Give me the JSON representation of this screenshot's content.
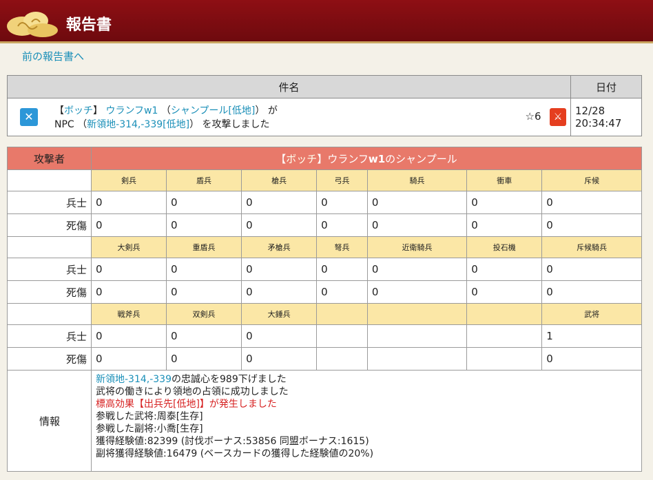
{
  "header": {
    "title": "報告書"
  },
  "back_link": "前の報告書へ",
  "subject_table": {
    "col_subject": "件名",
    "col_date": "日付",
    "row": {
      "alliance": "ボッチ",
      "attacker_name": "ウランフw1",
      "village": "シャンプール[低地]",
      "ga": "が",
      "npc_prefix": "NPC",
      "target": "新領地-314,-339[低地]",
      "action": "を攻撃しました",
      "stars": "☆6",
      "date": "12/28",
      "time": "20:34:47"
    }
  },
  "battle": {
    "attacker_label": "攻撃者",
    "attacker_alliance": "ボッチ",
    "attacker_name": "ウランフ",
    "attacker_name_bold": "w1",
    "attacker_suffix": "のシャンプール",
    "row_soldiers": "兵士",
    "row_casualties": "死傷",
    "groups": [
      {
        "units": [
          "剣兵",
          "盾兵",
          "槍兵",
          "弓兵",
          "騎兵",
          "衝車",
          "斥候"
        ],
        "soldiers": [
          "0",
          "0",
          "0",
          "0",
          "0",
          "0",
          "0"
        ],
        "casualties": [
          "0",
          "0",
          "0",
          "0",
          "0",
          "0",
          "0"
        ]
      },
      {
        "units": [
          "大剣兵",
          "重盾兵",
          "矛槍兵",
          "弩兵",
          "近衛騎兵",
          "投石機",
          "斥候騎兵"
        ],
        "soldiers": [
          "0",
          "0",
          "0",
          "0",
          "0",
          "0",
          "0"
        ],
        "casualties": [
          "0",
          "0",
          "0",
          "0",
          "0",
          "0",
          "0"
        ]
      },
      {
        "units": [
          "戦斧兵",
          "双剣兵",
          "大錘兵",
          "",
          "",
          "",
          "武将"
        ],
        "soldiers": [
          "0",
          "0",
          "0",
          "",
          "",
          "",
          "1"
        ],
        "casualties": [
          "0",
          "0",
          "0",
          "",
          "",
          "",
          "0"
        ]
      }
    ],
    "info_label": "情報",
    "info": {
      "line1_link": "新領地-314,-339",
      "line1_rest": "の忠誠心を989下げました",
      "line2": "武将の働きにより領地の占領に成功しました",
      "line3": "標高効果【出兵先[低地]】が発生しました",
      "line4": "参戦した武将:周泰[生存]",
      "line5": "参戦した副将:小喬[生存]",
      "line6": "獲得経験値:82399 (討伐ボーナス:53856 同盟ボーナス:1615)",
      "line7": "副将獲得経験値:16479 (ベースカードの獲得した経験値の20%)"
    }
  }
}
